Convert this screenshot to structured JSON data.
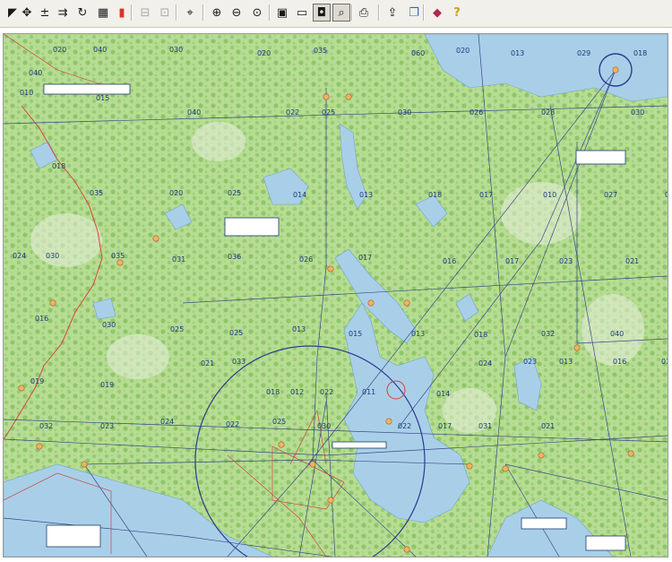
{
  "toolbar": {
    "buttons": [
      {
        "name": "select-arrow-icon",
        "glyph": "◤",
        "disabled": false,
        "active": false
      },
      {
        "name": "pan-tool-icon",
        "glyph": "✥",
        "disabled": false,
        "active": false
      },
      {
        "name": "ruler-plus-minus-icon",
        "glyph": "±",
        "disabled": false,
        "active": false
      },
      {
        "name": "route-fork-icon",
        "glyph": "⇉",
        "disabled": false,
        "active": false
      },
      {
        "name": "refresh-icon",
        "glyph": "↻",
        "disabled": false,
        "active": false
      },
      {
        "name": "grid-table-icon",
        "glyph": "▦",
        "disabled": false,
        "active": false
      },
      {
        "name": "map-layers-icon",
        "glyph": "▮",
        "disabled": false,
        "active": false
      },
      {
        "name": "prev-page-icon",
        "glyph": "⊟",
        "disabled": true,
        "active": false
      },
      {
        "name": "next-page-icon",
        "glyph": "⊡",
        "disabled": true,
        "active": false
      },
      {
        "name": "waypoint-tool-icon",
        "glyph": "⌖",
        "disabled": false,
        "active": false
      },
      {
        "name": "zoom-in-icon",
        "glyph": "⊕",
        "disabled": false,
        "active": false
      },
      {
        "name": "zoom-out-icon",
        "glyph": "⊖",
        "disabled": false,
        "active": false
      },
      {
        "name": "zoom-fit-icon",
        "glyph": "⊙",
        "disabled": false,
        "active": false
      },
      {
        "name": "full-extent-icon",
        "glyph": "▣",
        "disabled": false,
        "active": false
      },
      {
        "name": "monitor-view-icon",
        "glyph": "▭",
        "disabled": false,
        "active": false
      },
      {
        "name": "frame-view-icon",
        "glyph": "◘",
        "disabled": false,
        "active": true
      },
      {
        "name": "magnifier-view-icon",
        "glyph": "⌕",
        "disabled": false,
        "active": true
      },
      {
        "name": "print-tool-icon",
        "glyph": "⎙",
        "disabled": false,
        "active": false
      },
      {
        "name": "export-tool-icon",
        "glyph": "⇪",
        "disabled": false,
        "active": false
      },
      {
        "name": "layer-copy-icon",
        "glyph": "❐",
        "disabled": false,
        "active": false
      },
      {
        "name": "book-icon",
        "glyph": "◆",
        "disabled": false,
        "active": false
      },
      {
        "name": "help-key-icon",
        "glyph": "?",
        "disabled": false,
        "active": false
      }
    ]
  },
  "map": {
    "grid_numbers": [
      "020",
      "040",
      "030",
      "020",
      "035",
      "060",
      "020",
      "013",
      "029",
      "018",
      "040",
      "010",
      "015",
      "040",
      "022",
      "025",
      "030",
      "026",
      "028",
      "030",
      "018",
      "035",
      "020",
      "025",
      "014",
      "013",
      "018",
      "017",
      "010",
      "027",
      "023",
      "024",
      "030",
      "035",
      "031",
      "036",
      "026",
      "017",
      "016",
      "017",
      "023",
      "021",
      "016",
      "030",
      "025",
      "025",
      "013",
      "015",
      "013",
      "018",
      "032",
      "040",
      "012",
      "019",
      "019",
      "021",
      "033",
      "018",
      "012",
      "022",
      "011",
      "014",
      "024",
      "023",
      "013",
      "016",
      "032",
      "023",
      "024",
      "022",
      "025",
      "030",
      "022",
      "017",
      "031",
      "021",
      "014"
    ]
  }
}
